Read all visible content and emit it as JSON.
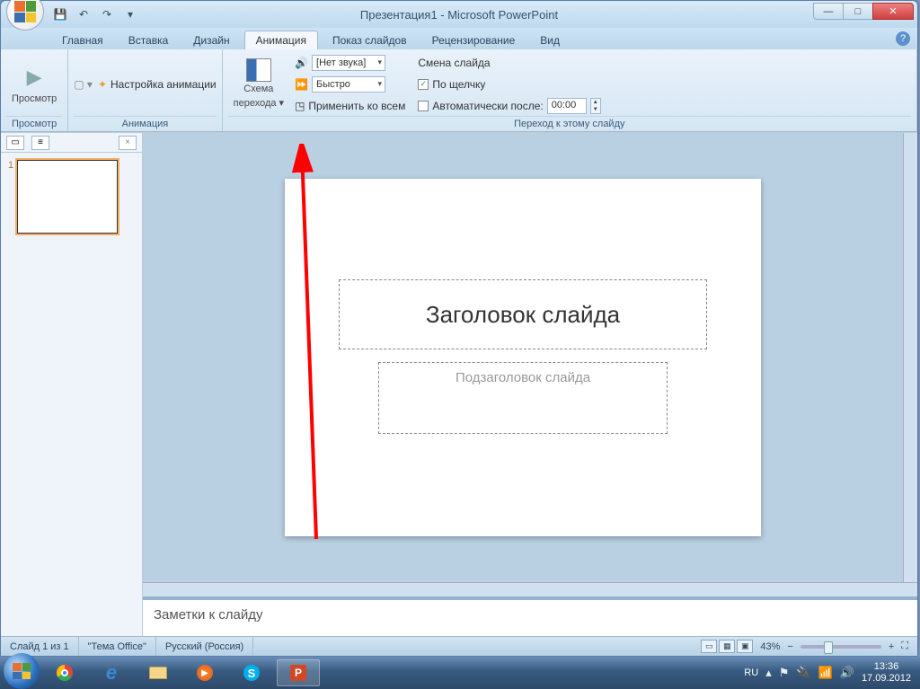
{
  "titlebar": {
    "title": "Презентация1 - Microsoft PowerPoint"
  },
  "tabs": {
    "items": [
      "Главная",
      "Вставка",
      "Дизайн",
      "Анимация",
      "Показ слайдов",
      "Рецензирование",
      "Вид"
    ],
    "active": "Анимация"
  },
  "ribbon": {
    "preview_group": {
      "btn": "Просмотр",
      "label": "Просмотр"
    },
    "animation_group": {
      "btn": "Настройка анимации",
      "label": "Анимация"
    },
    "transition_group": {
      "scheme_btn_line1": "Схема",
      "scheme_btn_line2": "перехода",
      "sound_label": "[Нет звука]",
      "speed_label": "Быстро",
      "apply_all": "Применить ко всем",
      "change_header": "Смена слайда",
      "on_click": "По щелчку",
      "auto_after": "Автоматически после:",
      "auto_time": "00:00",
      "group_label": "Переход к этому слайду"
    }
  },
  "thumbnails": {
    "close": "×",
    "slide_num": "1"
  },
  "slide": {
    "title_placeholder": "Заголовок слайда",
    "subtitle_placeholder": "Подзаголовок слайда"
  },
  "notes": {
    "placeholder": "Заметки к слайду"
  },
  "status": {
    "slide_of": "Слайд 1 из 1",
    "theme": "\"Тема Office\"",
    "lang": "Русский (Россия)",
    "zoom": "43%"
  },
  "taskbar": {
    "lang": "RU",
    "time": "13:36",
    "date": "17.09.2012"
  }
}
